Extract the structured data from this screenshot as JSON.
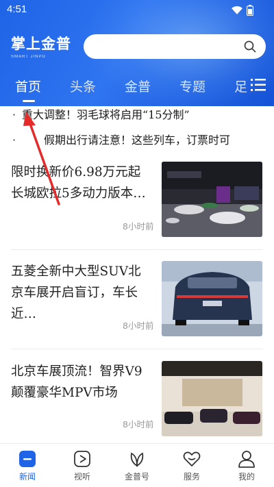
{
  "status_bar": {
    "time": "4:51"
  },
  "header": {
    "logo_text": "掌上金普",
    "logo_subtitle": "SMART JINPU",
    "search_placeholder": ""
  },
  "tabs": [
    {
      "label": "首页",
      "active": true
    },
    {
      "label": "头条",
      "active": false
    },
    {
      "label": "金普",
      "active": false
    },
    {
      "label": "专题",
      "active": false
    },
    {
      "label": "足",
      "active": false
    }
  ],
  "ticker": [
    {
      "text": "重大调整！羽毛球将启用“15分制”"
    },
    {
      "text": "　　假期出行请注意！这些列车，订票时可"
    }
  ],
  "news": [
    {
      "title": "限时换新价6.98万元起 长城欧拉5多动力版本…",
      "time": "8小时前",
      "icon": "car-show-photo"
    },
    {
      "title": "五菱全新中大型SUV北京车展开启盲订，车长近…",
      "time": "8小时前",
      "icon": "suv-rear-photo"
    },
    {
      "title": "北京车展顶流！智界V9颠覆豪华MPV市场",
      "time": "8小时前",
      "icon": "mpv-showroom-photo"
    }
  ],
  "bottom_nav": [
    {
      "label": "新闻",
      "icon": "news-icon",
      "active": true
    },
    {
      "label": "视听",
      "icon": "play-icon",
      "active": false
    },
    {
      "label": "金普号",
      "icon": "leaf-icon",
      "active": false
    },
    {
      "label": "服务",
      "icon": "heart-icon",
      "active": false
    },
    {
      "label": "我的",
      "icon": "user-icon",
      "active": false
    }
  ],
  "colors": {
    "brand_blue": "#1f64e6",
    "annotation_red": "#e52a2a"
  }
}
